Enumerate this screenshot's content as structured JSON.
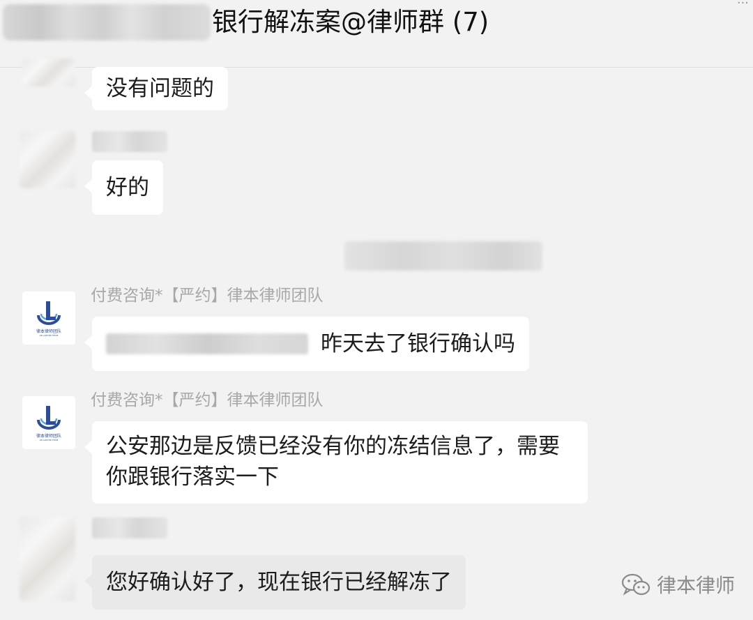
{
  "header": {
    "title": "银行解冻案@律师群 (7)",
    "more_icon": "ellipsis-icon"
  },
  "messages": [
    {
      "text": "没有问题的"
    },
    {
      "text": "好的"
    },
    {
      "sender": "付费咨询*【严约】律本律师团队",
      "text": "昨天去了银行确认吗"
    },
    {
      "sender": "付费咨询*【严约】律本律师团队",
      "line1": "公安那边是反馈已经没有你的冻结信息了，需要",
      "line2": "你跟银行落实一下"
    },
    {
      "text": "您好确认好了，现在银行已经解冻了"
    }
  ],
  "logo": {
    "text": "律本律师团队",
    "sub": "LB LAWYER TEAM",
    "color": "#2b4d9b"
  },
  "watermark": {
    "text": "律本律师",
    "icon": "wechat-icon"
  }
}
